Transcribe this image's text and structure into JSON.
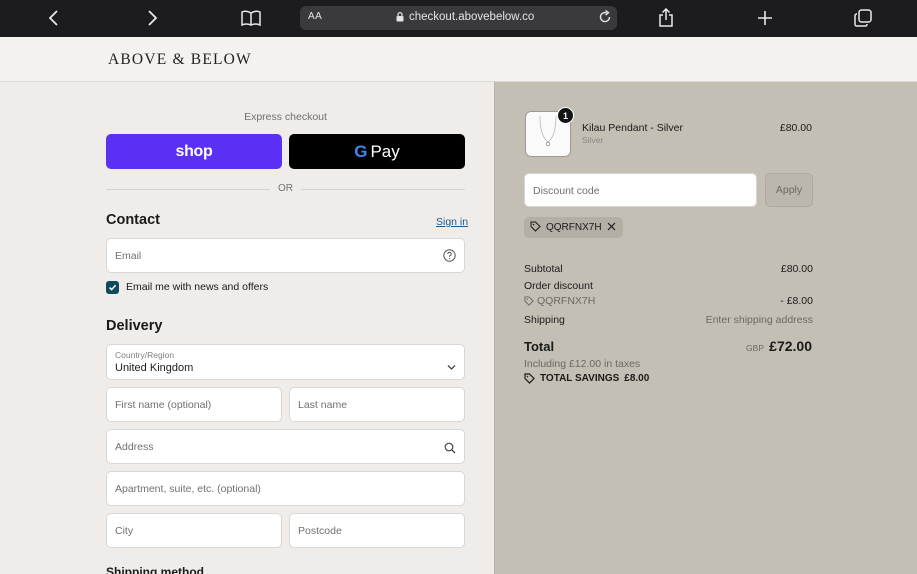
{
  "browser": {
    "text_size_label": "AA",
    "url": "checkout.abovebelow.co"
  },
  "store": {
    "name": "ABOVE & BELOW"
  },
  "express": {
    "label": "Express checkout",
    "shop_pay_label": "shop",
    "gpay_label": "Pay",
    "gpay_g": "G",
    "or_label": "OR"
  },
  "contact": {
    "title": "Contact",
    "sign_in_label": "Sign in",
    "email_placeholder": "Email",
    "newsletter_label": "Email me with news and offers",
    "newsletter_checked": true
  },
  "delivery": {
    "title": "Delivery",
    "country_label": "Country/Region",
    "country_value": "United Kingdom",
    "first_name_placeholder": "First name (optional)",
    "last_name_placeholder": "Last name",
    "address_placeholder": "Address",
    "apartment_placeholder": "Apartment, suite, etc. (optional)",
    "city_placeholder": "City",
    "postcode_placeholder": "Postcode"
  },
  "shipping_method": {
    "title": "Shipping method"
  },
  "order": {
    "item": {
      "quantity": "1",
      "name": "Kilau Pendant - Silver",
      "variant": "Silver",
      "price": "£80.00"
    },
    "discount_placeholder": "Discount code",
    "apply_label": "Apply",
    "applied_code": "QQRFNX7H",
    "subtotal_label": "Subtotal",
    "subtotal_value": "£80.00",
    "order_discount_label": "Order discount",
    "discount_code": "QQRFNX7H",
    "discount_value": "- £8.00",
    "shipping_label": "Shipping",
    "shipping_value": "Enter shipping address",
    "total_label": "Total",
    "currency": "GBP",
    "total_value": "£72.00",
    "tax_note": "Including £12.00 in taxes",
    "savings_label": "TOTAL SAVINGS",
    "savings_value": "£8.00"
  },
  "colors": {
    "shop_pay": "#5a31f4",
    "checkbox": "#0f4a5c",
    "summary_bg": "#c3bfb4"
  }
}
